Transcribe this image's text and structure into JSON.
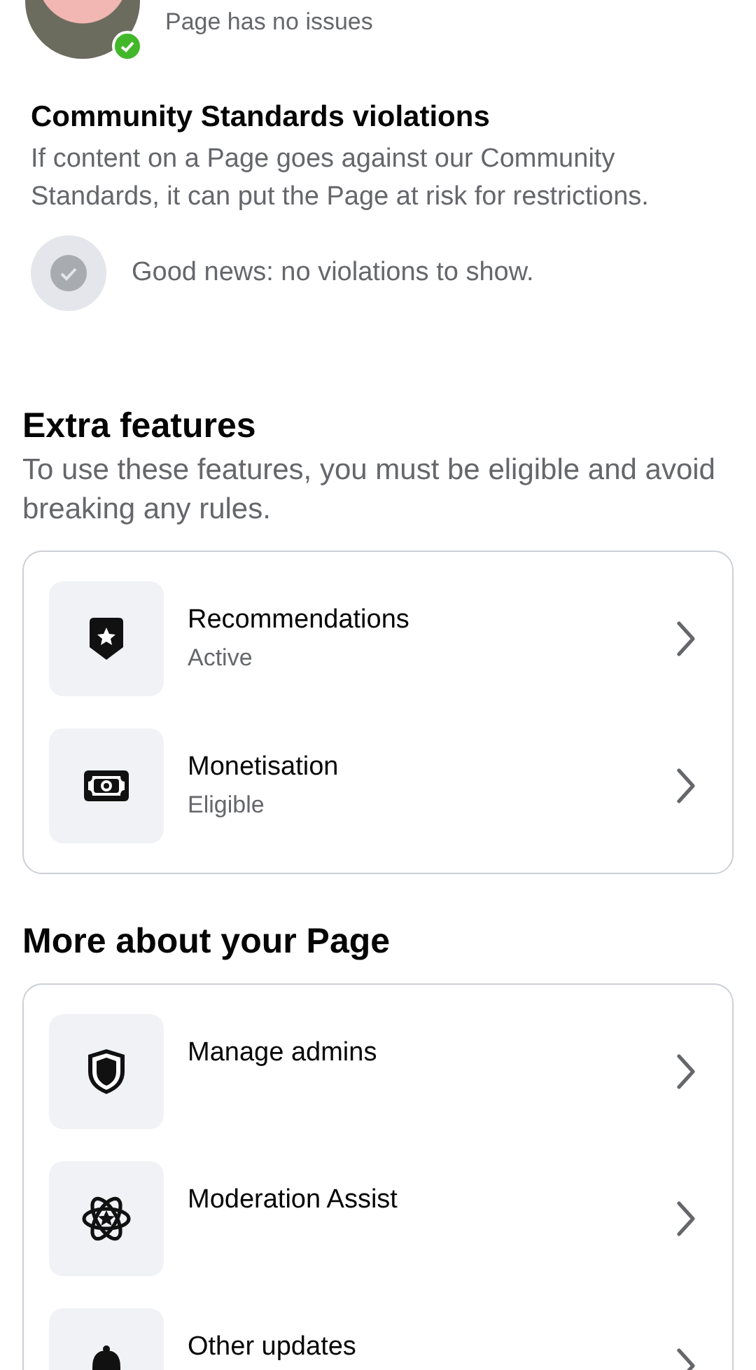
{
  "page_status": {
    "text": "Page has no issues",
    "verified": true
  },
  "community_standards": {
    "title": "Community Standards violations",
    "description": "If content on a Page goes against our Community Standards, it can put the Page at risk for restrictions.",
    "status": "Good news: no violations to show."
  },
  "extra_features": {
    "title": "Extra features",
    "description": "To use these features, you must be eligible and avoid breaking any rules.",
    "items": [
      {
        "kind": "recommendations",
        "title": "Recommendations",
        "subtitle": "Active"
      },
      {
        "kind": "money",
        "title": "Monetisation",
        "subtitle": "Eligible"
      }
    ]
  },
  "more_about_page": {
    "title": "More about your Page",
    "items": [
      {
        "kind": "admins",
        "title": "Manage admins"
      },
      {
        "kind": "moderation",
        "title": "Moderation Assist"
      },
      {
        "kind": "updates",
        "title": "Other updates"
      }
    ]
  }
}
